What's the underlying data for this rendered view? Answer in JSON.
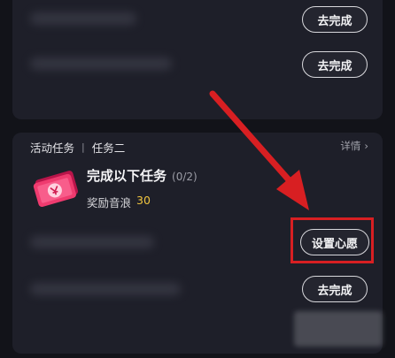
{
  "top_card": {
    "buttons": [
      "去完成",
      "去完成"
    ]
  },
  "activity": {
    "breadcrumb": [
      "活动任务",
      "任务二"
    ],
    "details_label": "详情",
    "details_chevron": "›",
    "task_title": "完成以下任务",
    "task_progress": "(0/2)",
    "reward_label": "奖励音浪",
    "reward_value": "30",
    "rows": [
      {
        "button": "设置心愿",
        "highlighted": true
      },
      {
        "button": "去完成",
        "highlighted": false
      }
    ]
  },
  "annotation": {
    "arrow_color": "#d81f22",
    "box_color": "#d81f22"
  },
  "icons": {
    "reward_ticket": "ticket-icon",
    "details": "chevron-right-icon"
  }
}
